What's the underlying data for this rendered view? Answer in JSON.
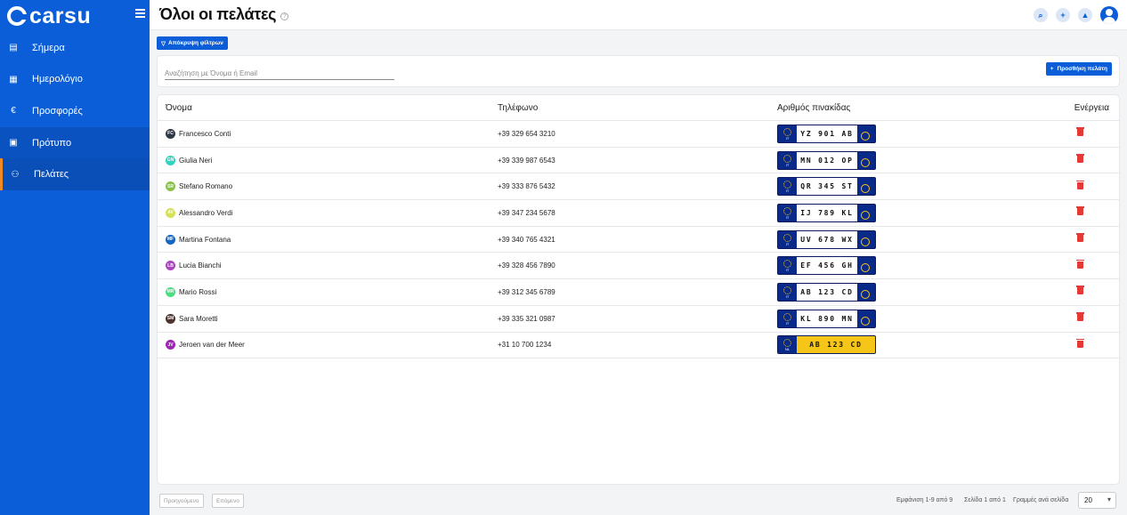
{
  "sidebar": {
    "brand": "carsu",
    "items": [
      {
        "label": "Σήμερα",
        "icon": "today-icon",
        "glyph": "▤"
      },
      {
        "label": "Ημερολόγιο",
        "icon": "calendar-icon",
        "glyph": "▦"
      },
      {
        "label": "Προσφορές",
        "icon": "euro-icon",
        "glyph": "€"
      },
      {
        "label": "Πρότυπο",
        "icon": "clipboard-icon",
        "glyph": "▣"
      },
      {
        "label": "Πελάτες",
        "icon": "users-icon",
        "glyph": "⚇"
      }
    ]
  },
  "header": {
    "title": "Όλοι οι πελάτες",
    "help": "?",
    "icons": [
      "search-icon",
      "add-circle-icon",
      "bell-icon",
      "user-avatar-icon"
    ]
  },
  "filters": {
    "hide_label": "Απόκρυψη φίλτρων"
  },
  "search": {
    "placeholder": "Αναζήτηση με Όνομα ή Email",
    "value": ""
  },
  "add_button": {
    "label": "Προσθήκη πελάτη",
    "glyph": "+"
  },
  "table": {
    "columns": [
      "Όνομα",
      "Τηλέφωνο",
      "Αριθμός πινακίδας",
      "Ενέργεια"
    ],
    "rows": [
      {
        "initials": "FC",
        "color": "#2f3a45",
        "name": "Francesco Conti",
        "phone": "+39 329 654 3210",
        "plate": "YZ 901 AB",
        "country": "IT",
        "style": "it"
      },
      {
        "initials": "GN",
        "color": "#2dd4bf",
        "name": "Giulia Neri",
        "phone": "+39 339 987 6543",
        "plate": "MN 012 OP",
        "country": "IT",
        "style": "it"
      },
      {
        "initials": "SR",
        "color": "#8bc34a",
        "name": "Stefano Romano",
        "phone": "+39 333 876 5432",
        "plate": "QR 345 ST",
        "country": "IT",
        "style": "it"
      },
      {
        "initials": "AV",
        "color": "#d4e157",
        "name": "Alessandro Verdi",
        "phone": "+39 347 234 5678",
        "plate": "IJ 789 KL",
        "country": "IT",
        "style": "it"
      },
      {
        "initials": "MF",
        "color": "#1565c0",
        "name": "Martina Fontana",
        "phone": "+39 340 765 4321",
        "plate": "UV 678 WX",
        "country": "IT",
        "style": "it"
      },
      {
        "initials": "LB",
        "color": "#ab47bc",
        "name": "Lucia Bianchi",
        "phone": "+39 328 456 7890",
        "plate": "EF 456 GH",
        "country": "IT",
        "style": "it"
      },
      {
        "initials": "MR",
        "color": "#4ade80",
        "name": "Mario Rossi",
        "phone": "+39 312 345 6789",
        "plate": "AB 123 CD",
        "country": "IT",
        "style": "it"
      },
      {
        "initials": "SM",
        "color": "#4e342e",
        "name": "Sara Moretti",
        "phone": "+39 335 321 0987",
        "plate": "KL 890 MN",
        "country": "IT",
        "style": "it"
      },
      {
        "initials": "JV",
        "color": "#9c27b0",
        "name": "Jeroen van der Meer",
        "phone": "+31 10 700 1234",
        "plate": "AB 123 CD",
        "country": "NL",
        "style": "nl"
      }
    ]
  },
  "pagination": {
    "prev": "Προηγούμενο",
    "next": "Επόμενο",
    "showing": "Εμφάνιση 1-9 από 9",
    "page": "Σελίδα 1 από 1",
    "rows_label": "Γραμμές ανά σελίδα",
    "rows_value": "20"
  },
  "colors": {
    "primary": "#0b5ed7",
    "active_marker": "#f08a24",
    "delete": "#e53935",
    "plate_blue": "#0a2a8a",
    "plate_yellow": "#f5c518"
  }
}
